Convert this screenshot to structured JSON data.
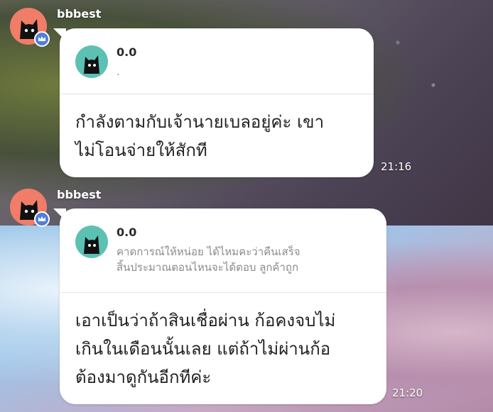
{
  "messages": [
    {
      "sender": "bbbest",
      "avatar_icon": "black-cat-icon",
      "badge_icon": "crown-icon",
      "reply": {
        "name": "0.0",
        "text": "."
      },
      "text_lines": [
        "กำลังตามกับเจ้านายเบลอยู่ค่ะ เขา",
        "ไม่โอนจ่ายให้สักที"
      ],
      "time": "21:16"
    },
    {
      "sender": "bbbest",
      "avatar_icon": "black-cat-icon",
      "badge_icon": "crown-icon",
      "reply": {
        "name": "0.0",
        "text_lines": [
          "คาดการณ์ให้หน่อย ได้ไหมคะว่าคืนเสร็จ",
          "สิ้นประมาณตอนไหนจะได้ตอบ ลูกค้าถูก"
        ]
      },
      "text_lines": [
        "เอาเป็นว่าถ้าสินเชื่อผ่าน ก้อคงจบไม่",
        "เกินในเดือนนั้นเลย แต่ถ้าไม่ผ่านก้อ",
        "ต้องมาดูกันอีกทีค่ะ"
      ],
      "time": "21:20"
    }
  ],
  "colors": {
    "avatar_bg": "#f07d68",
    "reply_avatar_bg": "#5cc1b3",
    "crown_badge": "#4f7fd8"
  }
}
